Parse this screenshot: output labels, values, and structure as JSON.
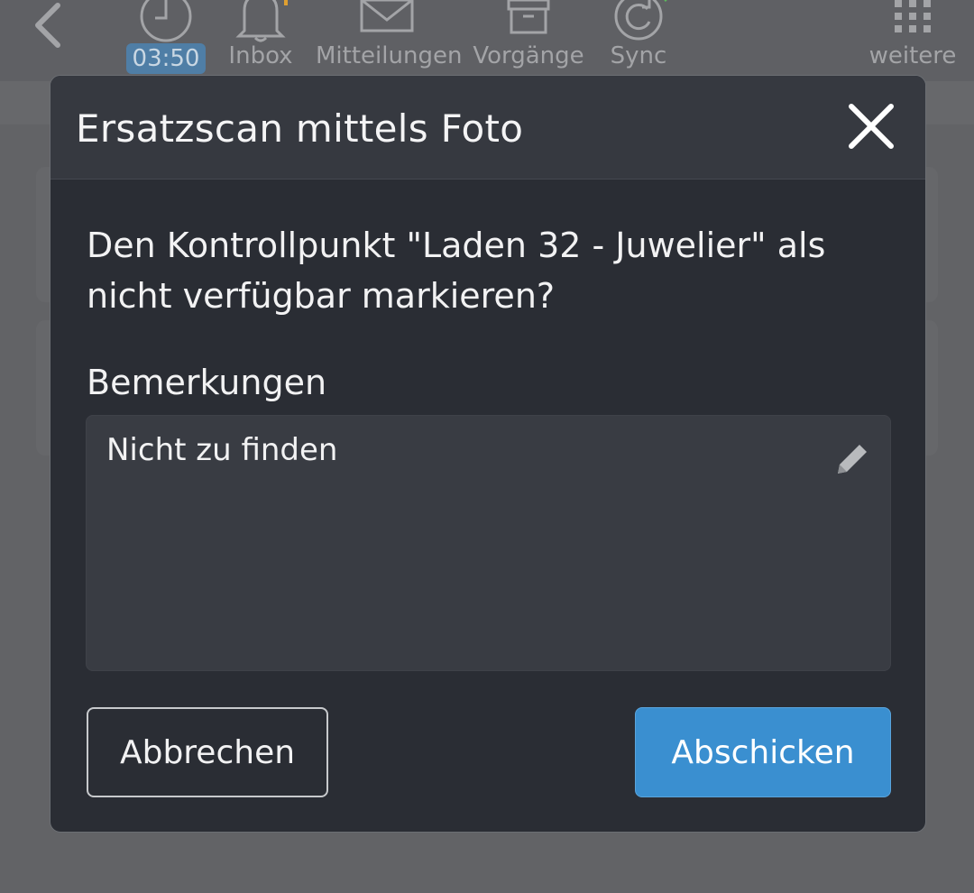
{
  "topbar": {
    "time": "03:50",
    "items": [
      {
        "label": "Inbox",
        "icon": "bell-icon"
      },
      {
        "label": "Mitteilungen",
        "icon": "envelope-icon"
      },
      {
        "label": "Vorgänge",
        "icon": "archive-box-icon"
      },
      {
        "label": "Sync",
        "icon": "sync-icon"
      },
      {
        "label": "weitere",
        "icon": "grid-icon"
      }
    ]
  },
  "dialog": {
    "title": "Ersatzscan mittels Foto",
    "question": "Den Kontrollpunkt \"Laden 32 - Juwelier\" als nicht verfügbar markieren?",
    "remarks_label": "Bemerkungen",
    "remarks_value": "Nicht zu finden",
    "cancel_label": "Abbrechen",
    "submit_label": "Abschicken"
  },
  "colors": {
    "accent": "#3a8fd0",
    "dialog_bg": "#2a2d34",
    "sync_ok": "#5cb85c",
    "inbox_badge": "#e0a030"
  }
}
